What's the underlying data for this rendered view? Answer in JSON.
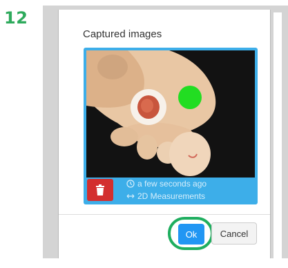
{
  "step": {
    "number": "12"
  },
  "dialog": {
    "title": "Captured images",
    "image_card": {
      "timestamp": "a few seconds ago",
      "mode": "2D Measurements",
      "timestamp_icon": "clock-icon",
      "mode_icon": "arrows-horizontal-icon",
      "delete_icon": "trash-icon",
      "delete_color": "#d32f2f",
      "card_color": "#3daee9"
    },
    "buttons": {
      "ok": "Ok",
      "cancel": "Cancel",
      "ok_color": "#2196f3",
      "highlight_color": "#1fae5f"
    }
  },
  "colors": {
    "step_number": "#2eaa5c",
    "marker": "#22dd22"
  }
}
